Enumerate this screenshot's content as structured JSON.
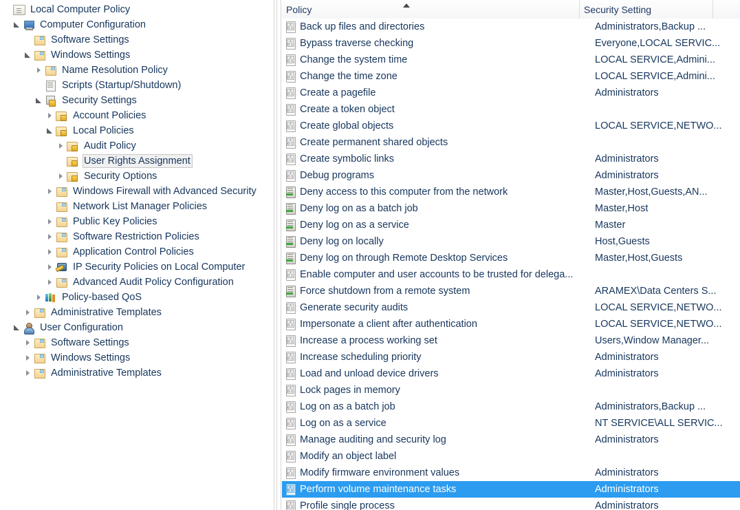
{
  "tree": {
    "name": "local-group-policy-editor-tree",
    "items": [
      {
        "label": "Local Computer Policy",
        "indent": 0,
        "twisty": "none",
        "icon": "policy-scroll-icon",
        "selected": false
      },
      {
        "label": "Computer Configuration",
        "indent": 1,
        "twisty": "expanded",
        "icon": "computer-monitor-icon",
        "selected": false
      },
      {
        "label": "Software Settings",
        "indent": 2,
        "twisty": "none",
        "icon": "folder-icon",
        "selected": false
      },
      {
        "label": "Windows Settings",
        "indent": 2,
        "twisty": "expanded",
        "icon": "folder-icon",
        "selected": false
      },
      {
        "label": "Name Resolution Policy",
        "indent": 3,
        "twisty": "collapsed",
        "icon": "folder-icon",
        "selected": false
      },
      {
        "label": "Scripts (Startup/Shutdown)",
        "indent": 3,
        "twisty": "none",
        "icon": "script-icon",
        "selected": false
      },
      {
        "label": "Security Settings",
        "indent": 3,
        "twisty": "expanded",
        "icon": "security-lock-icon",
        "selected": false
      },
      {
        "label": "Account Policies",
        "indent": 4,
        "twisty": "collapsed",
        "icon": "folder-lock-icon",
        "selected": false
      },
      {
        "label": "Local Policies",
        "indent": 4,
        "twisty": "expanded",
        "icon": "folder-lock-icon",
        "selected": false
      },
      {
        "label": "Audit Policy",
        "indent": 5,
        "twisty": "collapsed",
        "icon": "folder-lock-icon",
        "selected": false
      },
      {
        "label": "User Rights Assignment",
        "indent": 5,
        "twisty": "none",
        "icon": "folder-lock-icon",
        "selected": true
      },
      {
        "label": "Security Options",
        "indent": 5,
        "twisty": "collapsed",
        "icon": "folder-lock-icon",
        "selected": false
      },
      {
        "label": "Windows Firewall with Advanced Security",
        "indent": 4,
        "twisty": "collapsed",
        "icon": "folder-icon",
        "selected": false
      },
      {
        "label": "Network List Manager Policies",
        "indent": 4,
        "twisty": "none",
        "icon": "folder-icon",
        "selected": false
      },
      {
        "label": "Public Key Policies",
        "indent": 4,
        "twisty": "collapsed",
        "icon": "folder-icon",
        "selected": false
      },
      {
        "label": "Software Restriction Policies",
        "indent": 4,
        "twisty": "collapsed",
        "icon": "folder-icon",
        "selected": false
      },
      {
        "label": "Application Control Policies",
        "indent": 4,
        "twisty": "collapsed",
        "icon": "folder-icon",
        "selected": false
      },
      {
        "label": "IP Security Policies on Local Computer",
        "indent": 4,
        "twisty": "collapsed",
        "icon": "ip-security-icon",
        "selected": false
      },
      {
        "label": "Advanced Audit Policy Configuration",
        "indent": 4,
        "twisty": "collapsed",
        "icon": "folder-icon",
        "selected": false
      },
      {
        "label": "Policy-based QoS",
        "indent": 3,
        "twisty": "collapsed",
        "icon": "qos-chart-icon",
        "selected": false
      },
      {
        "label": "Administrative Templates",
        "indent": 2,
        "twisty": "collapsed",
        "icon": "folder-icon",
        "selected": false
      },
      {
        "label": "User Configuration",
        "indent": 1,
        "twisty": "expanded",
        "icon": "user-icon",
        "selected": false
      },
      {
        "label": "Software Settings",
        "indent": 2,
        "twisty": "collapsed",
        "icon": "folder-icon",
        "selected": false
      },
      {
        "label": "Windows Settings",
        "indent": 2,
        "twisty": "collapsed",
        "icon": "folder-icon",
        "selected": false
      },
      {
        "label": "Administrative Templates",
        "indent": 2,
        "twisty": "collapsed",
        "icon": "folder-icon",
        "selected": false
      }
    ]
  },
  "list": {
    "columns": [
      {
        "label": "Policy",
        "sorted": "asc"
      },
      {
        "label": "Security Setting",
        "sorted": "none"
      },
      {
        "label": "",
        "sorted": "none"
      }
    ],
    "selected_index": 28,
    "rows": [
      {
        "policy": "Back up files and directories",
        "setting": "Administrators,Backup ...",
        "icon": "user-right-icon"
      },
      {
        "policy": "Bypass traverse checking",
        "setting": "Everyone,LOCAL SERVIC...",
        "icon": "user-right-icon"
      },
      {
        "policy": "Change the system time",
        "setting": "LOCAL SERVICE,Admini...",
        "icon": "user-right-icon"
      },
      {
        "policy": "Change the time zone",
        "setting": "LOCAL SERVICE,Admini...",
        "icon": "user-right-icon"
      },
      {
        "policy": "Create a pagefile",
        "setting": "Administrators",
        "icon": "user-right-icon"
      },
      {
        "policy": "Create a token object",
        "setting": "",
        "icon": "user-right-icon"
      },
      {
        "policy": "Create global objects",
        "setting": "LOCAL SERVICE,NETWO...",
        "icon": "user-right-icon"
      },
      {
        "policy": "Create permanent shared objects",
        "setting": "",
        "icon": "user-right-icon"
      },
      {
        "policy": "Create symbolic links",
        "setting": "Administrators",
        "icon": "user-right-icon"
      },
      {
        "policy": "Debug programs",
        "setting": "Administrators",
        "icon": "user-right-icon"
      },
      {
        "policy": "Deny access to this computer from the network",
        "setting": "Master,Host,Guests,AN...",
        "icon": "deny-right-icon"
      },
      {
        "policy": "Deny log on as a batch job",
        "setting": "Master,Host",
        "icon": "deny-right-icon"
      },
      {
        "policy": "Deny log on as a service",
        "setting": "Master",
        "icon": "deny-right-icon"
      },
      {
        "policy": "Deny log on locally",
        "setting": "Host,Guests",
        "icon": "deny-right-icon"
      },
      {
        "policy": "Deny log on through Remote Desktop Services",
        "setting": "Master,Host,Guests",
        "icon": "deny-right-icon"
      },
      {
        "policy": "Enable computer and user accounts to be trusted for delega...",
        "setting": "",
        "icon": "user-right-icon"
      },
      {
        "policy": "Force shutdown from a remote system",
        "setting": "ARAMEX\\Data Centers S...",
        "icon": "deny-right-icon"
      },
      {
        "policy": "Generate security audits",
        "setting": "LOCAL SERVICE,NETWO...",
        "icon": "user-right-icon"
      },
      {
        "policy": "Impersonate a client after authentication",
        "setting": "LOCAL SERVICE,NETWO...",
        "icon": "user-right-icon"
      },
      {
        "policy": "Increase a process working set",
        "setting": "Users,Window Manager...",
        "icon": "user-right-icon"
      },
      {
        "policy": "Increase scheduling priority",
        "setting": "Administrators",
        "icon": "user-right-icon"
      },
      {
        "policy": "Load and unload device drivers",
        "setting": "Administrators",
        "icon": "user-right-icon"
      },
      {
        "policy": "Lock pages in memory",
        "setting": "",
        "icon": "user-right-icon"
      },
      {
        "policy": "Log on as a batch job",
        "setting": "Administrators,Backup ...",
        "icon": "user-right-icon"
      },
      {
        "policy": "Log on as a service",
        "setting": "NT SERVICE\\ALL SERVIC...",
        "icon": "user-right-icon"
      },
      {
        "policy": "Manage auditing and security log",
        "setting": "Administrators",
        "icon": "user-right-icon"
      },
      {
        "policy": "Modify an object label",
        "setting": "",
        "icon": "user-right-icon"
      },
      {
        "policy": "Modify firmware environment values",
        "setting": "Administrators",
        "icon": "user-right-icon"
      },
      {
        "policy": "Perform volume maintenance tasks",
        "setting": "Administrators",
        "icon": "user-right-icon"
      },
      {
        "policy": "Profile single process",
        "setting": "Administrators",
        "icon": "user-right-icon"
      }
    ]
  },
  "colors": {
    "selection_blue": "#2b9cf0",
    "text_navy": "#17365d",
    "header_text": "#1f3864",
    "tree_selection_bg": "#f0f0f0",
    "divider": "#d4d4d4"
  }
}
